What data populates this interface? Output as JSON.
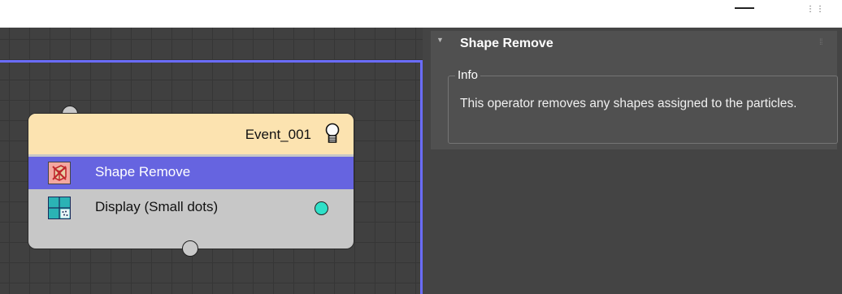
{
  "window": {
    "controls": {
      "minimize": "minimize",
      "maximize": "restore"
    }
  },
  "rollout": {
    "title": "Shape Remove",
    "group": {
      "title": "Info",
      "text": "This operator removes any shapes assigned to the particles."
    }
  },
  "node": {
    "title": "Event_001",
    "operators": [
      {
        "label": "Shape Remove",
        "icon": "shape-remove-icon",
        "selected": true
      },
      {
        "label": "Display (Small dots)",
        "icon": "display-icon",
        "output_color": "#2fe0c8"
      }
    ]
  },
  "colors": {
    "graph_bg": "#404040",
    "panel_bg": "#444444",
    "node_header": "#fce3b0",
    "node_body": "#c7c7c7",
    "selection": "#6664e0",
    "graph_border": "#6a6cff"
  }
}
